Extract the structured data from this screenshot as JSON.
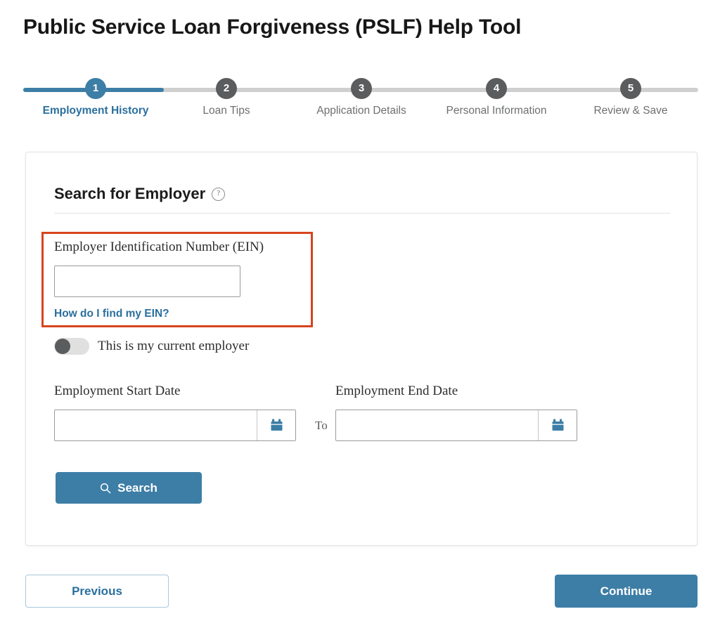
{
  "page": {
    "title": "Public Service Loan Forgiveness (PSLF) Help Tool"
  },
  "stepper": {
    "active_index": 0,
    "steps": [
      {
        "number": "1",
        "label": "Employment History"
      },
      {
        "number": "2",
        "label": "Loan Tips"
      },
      {
        "number": "3",
        "label": "Application Details"
      },
      {
        "number": "4",
        "label": "Personal Information"
      },
      {
        "number": "5",
        "label": "Review & Save"
      }
    ]
  },
  "card": {
    "title": "Search for Employer",
    "help_icon": "question-circle-icon",
    "ein": {
      "label": "Employer Identification Number (EIN)",
      "value": "",
      "placeholder": "",
      "link_text": "How do I find my EIN?",
      "highlight_color": "#d8441f"
    },
    "current_employer_toggle": {
      "label": "This is my current employer",
      "state": "off"
    },
    "dates": {
      "start_label": "Employment Start Date",
      "start_value": "",
      "start_placeholder": "",
      "separator": "To",
      "end_label": "Employment End Date",
      "end_value": "",
      "end_placeholder": "",
      "calendar_icon": "calendar-icon"
    },
    "search_button": {
      "label": "Search",
      "icon": "search-icon"
    }
  },
  "footer": {
    "previous_label": "Previous",
    "continue_label": "Continue"
  },
  "colors": {
    "accent_blue": "#3d7ea6",
    "link_blue": "#2a6f9e",
    "step_gray": "#5a5c5e",
    "highlight_red": "#d8441f"
  }
}
